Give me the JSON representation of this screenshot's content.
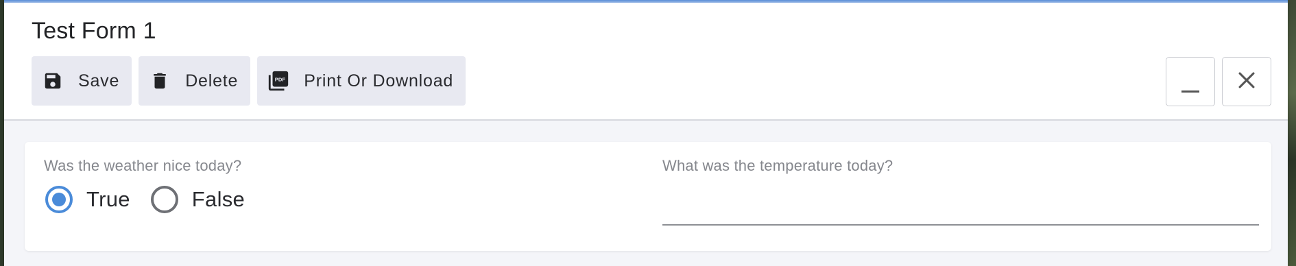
{
  "form": {
    "title": "Test Form 1"
  },
  "toolbar": {
    "save_label": "Save",
    "delete_label": "Delete",
    "print_label": "Print Or Download",
    "icons": {
      "save": "floppy-disk-icon",
      "delete": "trash-can-icon",
      "print": "pdf-file-icon"
    }
  },
  "window_controls": {
    "minimize_glyph": "_",
    "close_icon": "close-icon"
  },
  "questions": {
    "weather": {
      "label": "Was the weather nice today?",
      "options": [
        "True",
        "False"
      ],
      "selected": "True"
    },
    "temperature": {
      "label": "What was the temperature today?",
      "value": ""
    }
  },
  "colors": {
    "accent": "#4a8bd9",
    "button_bg": "#e8e9f1",
    "page_bg": "#f4f5f9"
  }
}
